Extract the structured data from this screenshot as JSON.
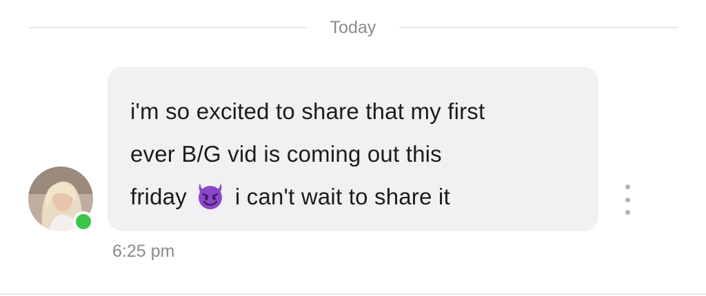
{
  "divider": {
    "label": "Today"
  },
  "message": {
    "line1": "i'm so excited to share that my first",
    "line2": "ever B/G vid is coming out this",
    "line3_before": "friday",
    "line3_after": "i can't wait to share it",
    "emoji": "smiling-face-with-horns-icon",
    "time": "6:25 pm"
  },
  "sender": {
    "online": true
  },
  "colors": {
    "bubble": "#f1f1f3",
    "online": "#3cc44b",
    "emoji": "#8b46c9",
    "muted_text": "#8a8a8f"
  }
}
